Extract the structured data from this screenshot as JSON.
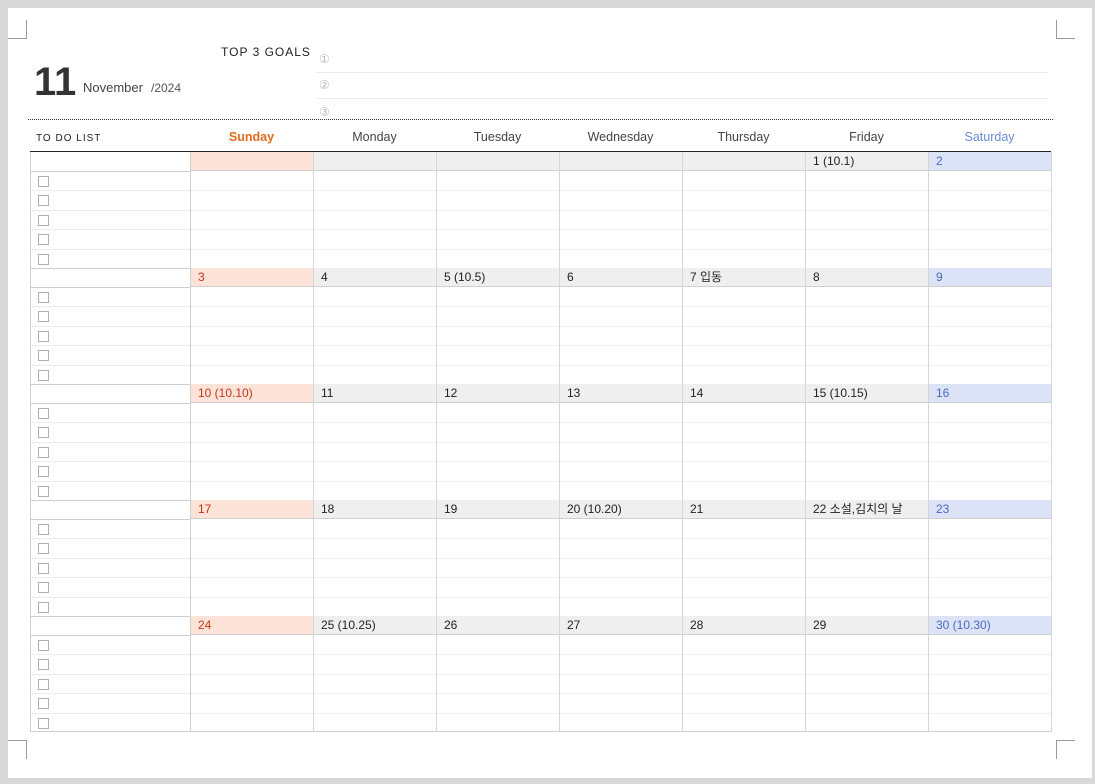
{
  "header": {
    "month_number": "11",
    "month_name": "November",
    "year": "/2024",
    "goals_title": "TOP 3 GOALS",
    "goal_markers": [
      "①",
      "②",
      "③"
    ]
  },
  "todo_header": "TO DO LIST",
  "days_of_week": [
    "Sunday",
    "Monday",
    "Tuesday",
    "Wednesday",
    "Thursday",
    "Friday",
    "Saturday"
  ],
  "colors": {
    "sunday": "#e06a1c",
    "saturday": "#6b8cd6",
    "sunday_bg": "#fde3d7",
    "saturday_bg": "#dde3f6"
  },
  "weeks": [
    [
      "",
      "",
      "",
      "",
      "",
      "1  (10.1)",
      "2"
    ],
    [
      "3",
      "4",
      "5  (10.5)",
      "6",
      "7  입동",
      "8",
      "9"
    ],
    [
      "10  (10.10)",
      "11",
      "12",
      "13",
      "14",
      "15  (10.15)",
      "16"
    ],
    [
      "17",
      "18",
      "19",
      "20  (10.20)",
      "21",
      "22  소설,김치의 날",
      "23"
    ],
    [
      "24",
      "25  (10.25)",
      "26",
      "27",
      "28",
      "29",
      "30  (10.30)"
    ]
  ]
}
